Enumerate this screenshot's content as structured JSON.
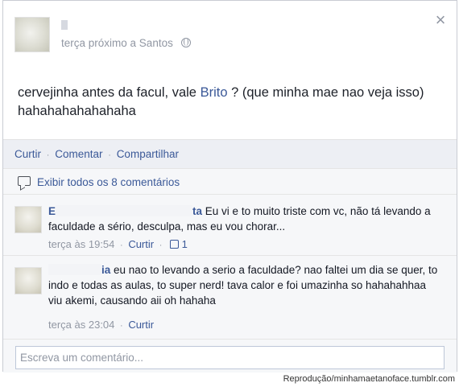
{
  "post": {
    "author_name": "L",
    "timestamp": "terça",
    "location_text": "próximo a Santos",
    "text_before": "cervejinha antes da facul, vale ",
    "mention": "Brito",
    "text_after": " ? (que minha mae nao veja isso) hahahahahahahaha"
  },
  "actions": {
    "like": "Curtir",
    "comment": "Comentar",
    "share": "Compartilhar",
    "separator": "·"
  },
  "comments_summary": {
    "view_all": "Exibir todos os 8 comentários"
  },
  "comments": [
    {
      "author_visible_start": "E",
      "author_visible_end": "ta",
      "text": "Eu vi e to muito triste com vc, não tá levando a faculdade a sério, desculpa, mas eu vou chorar...",
      "timestamp": "terça às 19:54",
      "like_label": "Curtir",
      "like_count": "1"
    },
    {
      "author_visible_end": "ia",
      "text": "eu nao to levando a serio a faculdade? nao faltei um dia se quer, to indo e todas as aulas, to super nerd! tava calor e foi umazinha so hahahahhaa viu akemi, causando aii oh hahaha",
      "timestamp": "terça às 23:04",
      "like_label": "Curtir"
    }
  ],
  "composer": {
    "placeholder": "Escreva um comentário..."
  },
  "credit": "Reprodução/minhamaetanoface.tumblr.com",
  "colors": {
    "link": "#3b5998",
    "muted": "#9197a3",
    "panel_bg": "#f6f7f9",
    "action_bar_bg": "#edeff4"
  },
  "icons": {
    "close": "close-icon",
    "globe": "globe-icon",
    "comment": "comment-bubble-icon",
    "like": "thumbs-up-icon"
  }
}
